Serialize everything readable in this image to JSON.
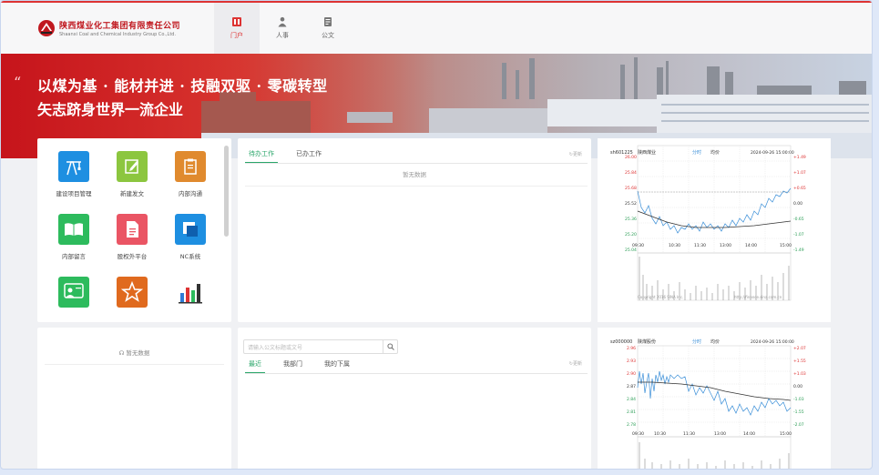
{
  "company": {
    "name_cn": "陕西煤业化工集团有限责任公司",
    "name_en": "Shaanxi Coal and Chemical Industry Group Co.,Ltd."
  },
  "nav": [
    {
      "label": "门户",
      "icon": "portal-icon",
      "active": true
    },
    {
      "label": "人事",
      "icon": "person-icon",
      "active": false
    },
    {
      "label": "公文",
      "icon": "document-icon",
      "active": false
    }
  ],
  "banner": {
    "quote_mark": "“",
    "line1": "以煤为基 · 能材并进 · 技融双驱 · 零碳转型",
    "line2": "矢志跻身世界一流企业"
  },
  "apps": [
    {
      "label": "建设项目管理",
      "icon": "construction-crane-icon",
      "color": "#1e8fe1"
    },
    {
      "label": "新建发文",
      "icon": "edit-document-icon",
      "color": "#8cc63f"
    },
    {
      "label": "内部沟通",
      "icon": "clipboard-icon",
      "color": "#e08a2e"
    },
    {
      "label": "内部留言",
      "icon": "open-book-icon",
      "color": "#2dbb5d"
    },
    {
      "label": "股权外平台",
      "icon": "file-icon",
      "color": "#ea5564"
    },
    {
      "label": "NC系统",
      "icon": "windows-icon",
      "color": "#1e8fe1"
    },
    {
      "label": "",
      "icon": "meeting-icon",
      "color": "#2dbb5d"
    },
    {
      "label": "",
      "icon": "star-badge-icon",
      "color": "#e06a1e"
    },
    {
      "label": "",
      "icon": "bar-chart-icon",
      "color": "#ffffff"
    }
  ],
  "todo": {
    "tabs": [
      "待办工作",
      "已办工作"
    ],
    "refresh": "更新",
    "empty": "暂无数据"
  },
  "messages": {
    "empty": "暂无数据"
  },
  "docs": {
    "search_placeholder": "请输入公文标题或文号",
    "tabs": [
      "最近",
      "我部门",
      "我的下属"
    ],
    "refresh": "更新"
  },
  "stock1": {
    "code": "sh601225",
    "name": "陕西煤业",
    "legend": [
      "分时",
      "均价"
    ],
    "date": "2024-09-26 15:00:00",
    "y_left": [
      "26.00",
      "25.84",
      "25.68",
      "25.52",
      "25.36",
      "25.20",
      "25.04"
    ],
    "y_right": [
      "+1.49",
      "+1.07",
      "+0.65",
      "0.00",
      "-0.65",
      "-1.07",
      "-1.49"
    ],
    "times": [
      "09:30",
      "10:30",
      "11:30",
      "13:00",
      "14:00",
      "15:00"
    ],
    "copyright": "Copyright 2016 SINA Inc.",
    "url": "http://finance.sina.com.cn"
  },
  "stock2": {
    "code": "sz000000",
    "name": "陕煤股份",
    "legend": [
      "分时",
      "均价"
    ],
    "date": "2024-09-26 15:00:00",
    "y_left": [
      "2.96",
      "2.93",
      "2.90",
      "2.87",
      "2.84",
      "2.81",
      "2.78"
    ],
    "y_right": [
      "+2.07",
      "+1.55",
      "+1.03",
      "0.00",
      "-1.03",
      "-1.55",
      "-2.07"
    ],
    "times": [
      "09:30",
      "10:30",
      "11:30",
      "13:00",
      "14:00",
      "15:00"
    ]
  },
  "colors": {
    "accent": "#d33333",
    "green": "#2aa66a",
    "line_blue": "#3b8fd8"
  }
}
